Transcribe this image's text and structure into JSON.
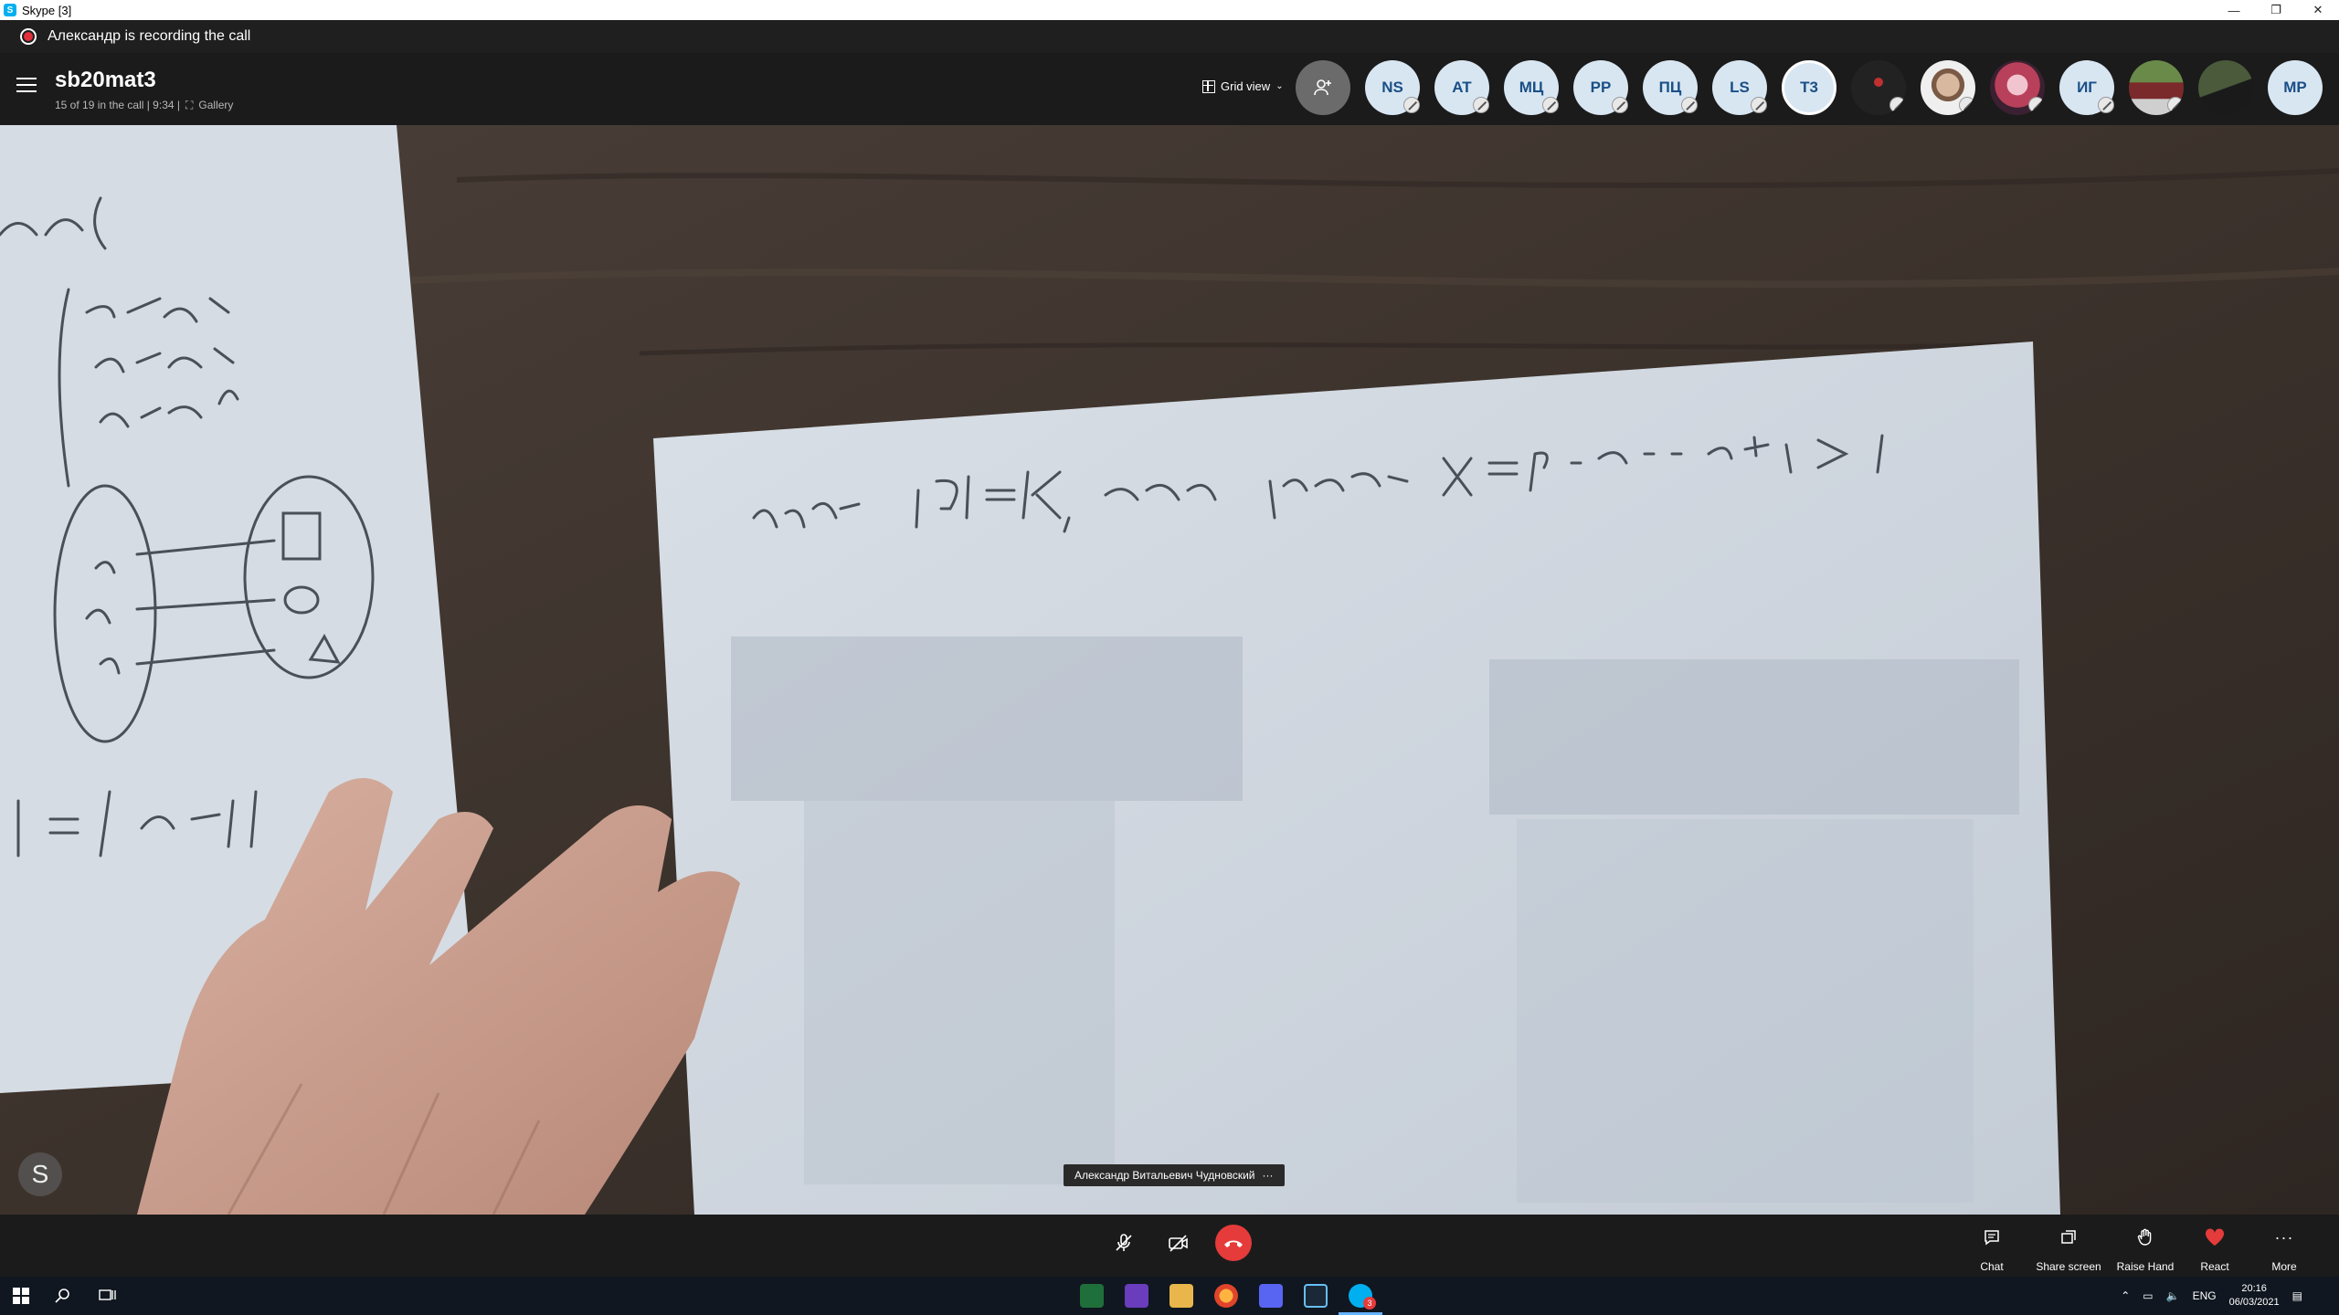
{
  "window": {
    "title": "Skype [3]",
    "controls": [
      "—",
      "❐",
      "✕"
    ]
  },
  "banner": {
    "text": "Александр is recording the call"
  },
  "call": {
    "title": "sb20mat3",
    "subtitle": "15 of 19 in the call | 9:34 |",
    "view_mode": "Gallery",
    "grid_view_label": "Grid view"
  },
  "participants": [
    {
      "initials": "",
      "kind": "add"
    },
    {
      "initials": "NS"
    },
    {
      "initials": "AT"
    },
    {
      "initials": "МЦ"
    },
    {
      "initials": "PP"
    },
    {
      "initials": "ПЦ"
    },
    {
      "initials": "LS"
    },
    {
      "initials": "T3",
      "active": true
    },
    {
      "initials": "",
      "kind": "photo"
    },
    {
      "initials": "",
      "kind": "photo"
    },
    {
      "initials": "",
      "kind": "photo"
    },
    {
      "initials": "ИГ"
    },
    {
      "initials": "",
      "kind": "photo"
    },
    {
      "initials": "",
      "kind": "photo"
    },
    {
      "initials": "MP"
    }
  ],
  "video": {
    "speaker_name": "Александр Витальевич Чудновский",
    "speaker_more": "···",
    "watermark": "S"
  },
  "controls": {
    "chat_label": "Chat",
    "share_label": "Share screen",
    "raise_hand_label": "Raise Hand",
    "react_label": "React",
    "more_label": "More"
  },
  "taskbar": {
    "lang": "ENG",
    "time": "20:16",
    "date": "06/03/2021",
    "skype_badge": "3"
  },
  "colors": {
    "hangup": "#e53b3b",
    "react_heart": "#e53b3b",
    "accent": "#00aff0"
  }
}
